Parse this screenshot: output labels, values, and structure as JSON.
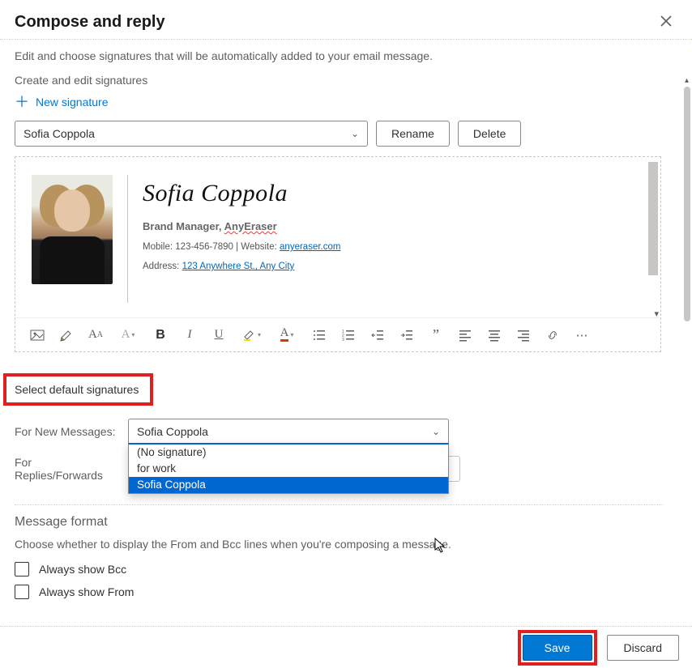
{
  "header": {
    "title": "Compose and reply"
  },
  "intro": "Edit and choose signatures that will be automatically added to your email message.",
  "create_label": "Create and edit signatures",
  "new_signature_label": "New signature",
  "signatureSelect": {
    "value": "Sofia Coppola"
  },
  "buttons": {
    "rename": "Rename",
    "delete": "Delete",
    "save": "Save",
    "discard": "Discard"
  },
  "signature": {
    "name": "Sofia Coppola",
    "title_prefix": "Brand Manager, ",
    "title_company": "AnyEraser",
    "mobile_label": "Mobile: ",
    "mobile": "123-456-7890",
    "sep": "  |  ",
    "website_label": "Website: ",
    "website": "anyeraser.com",
    "address_label": "Address: ",
    "address": "123 Anywhere St., Any City"
  },
  "defaults": {
    "section_title": "Select default signatures",
    "new_msg_label": "For New Messages:",
    "replies_label": "For Replies/Forwards",
    "new_msg_value": "Sofia Coppola",
    "options": [
      "(No signature)",
      "for work",
      "Sofia Coppola"
    ],
    "selected_index": 2
  },
  "messageFormat": {
    "title": "Message format",
    "sub": "Choose whether to display the From and Bcc lines when you're composing a message.",
    "bcc": "Always show Bcc",
    "from": "Always show From"
  },
  "toolbar_names": [
    "image-icon",
    "paint-icon",
    "font-case-icon",
    "font-size-icon",
    "bold-icon",
    "italic-icon",
    "underline-icon",
    "highlight-icon",
    "font-color-icon",
    "bullets-icon",
    "numbering-icon",
    "outdent-icon",
    "indent-icon",
    "quote-icon",
    "align-left-icon",
    "align-center-icon",
    "align-right-icon",
    "link-icon",
    "more-icon"
  ]
}
